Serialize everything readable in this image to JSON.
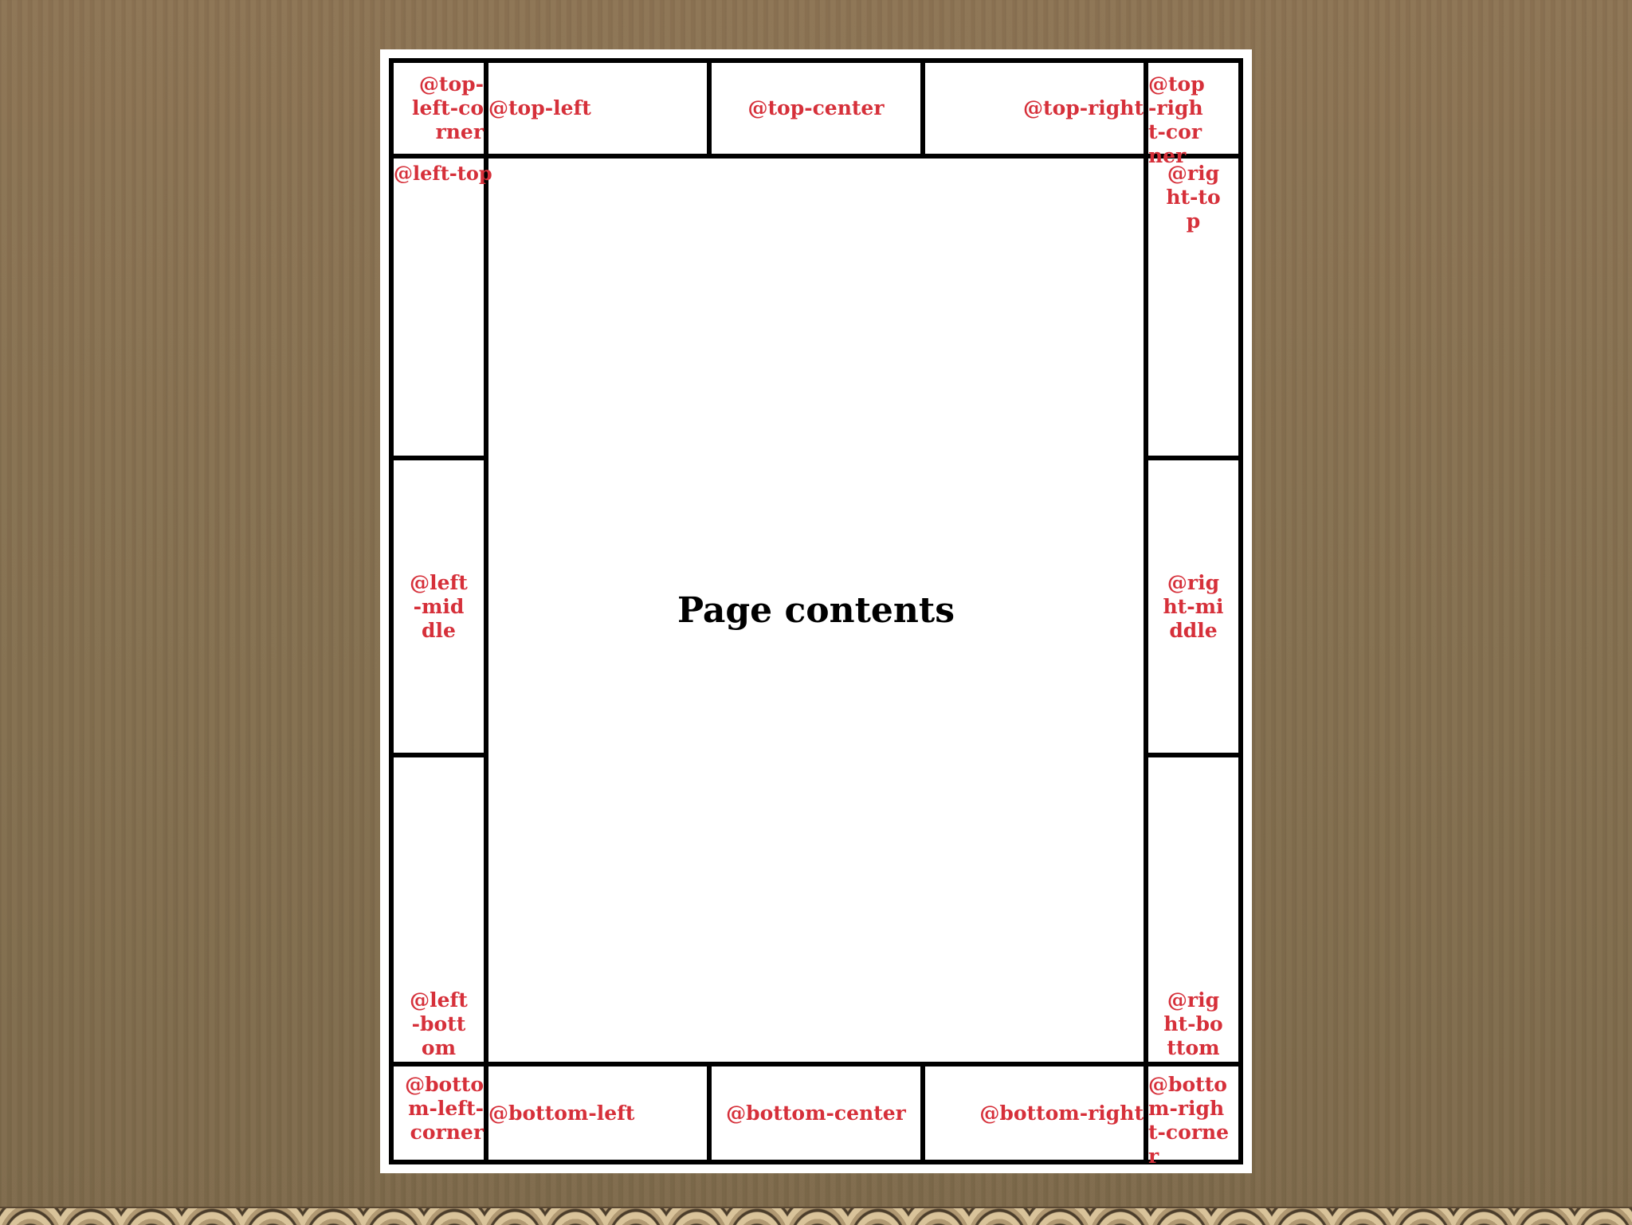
{
  "margin_boxes": {
    "top_left_corner": "@top-left-corner",
    "top_left": "@top-left",
    "top_center": "@top-center",
    "top_right": "@top-right",
    "top_right_corner": "@top-right-corner",
    "left_top": "@left-top",
    "left_middle": "@left-middle",
    "left_bottom": "@left-bottom",
    "right_top": "@right-top",
    "right_middle": "@right-middle",
    "right_bottom": "@right-bottom",
    "bottom_left_corner": "@bottom-left-corner",
    "bottom_left": "@bottom-left",
    "bottom_center": "@bottom-center",
    "bottom_right": "@bottom-right",
    "bottom_right_corner": "@bottom-right-corner"
  },
  "page_contents": "Page contents",
  "colors": {
    "label": "#d6303a",
    "border": "#000000",
    "paper": "#ffffff",
    "background": "#8a7151"
  }
}
